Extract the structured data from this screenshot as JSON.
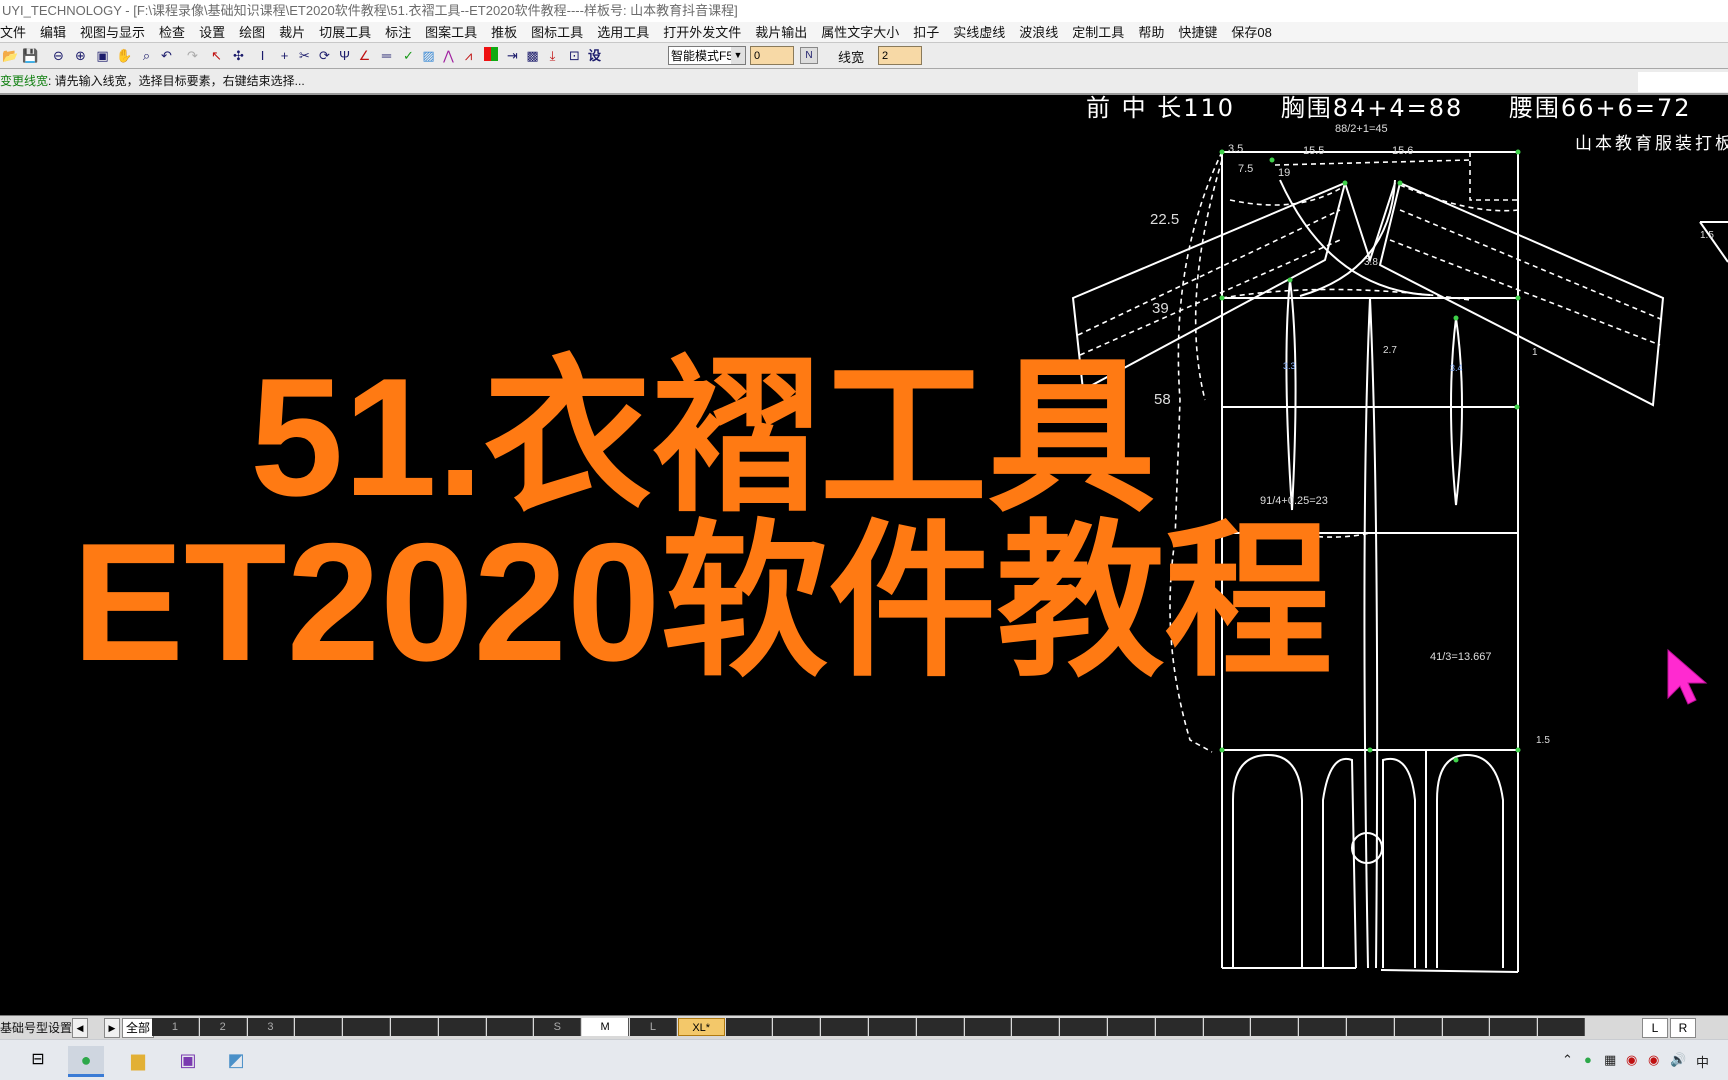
{
  "window": {
    "title": "UYI_TECHNOLOGY - [F:\\课程录像\\基础知识课程\\ET2020软件教程\\51.衣褶工具--ET2020软件教程----样板号: 山本教育抖音课程]"
  },
  "menu": [
    "文件",
    "编辑",
    "视图与显示",
    "检查",
    "设置",
    "绘图",
    "裁片",
    "切展工具",
    "标注",
    "图案工具",
    "推板",
    "图标工具",
    "选用工具",
    "打开外发文件",
    "裁片输出",
    "属性文字大小",
    "扣子",
    "实线虚线",
    "波浪线",
    "定制工具",
    "帮助",
    "快捷键",
    "保存08"
  ],
  "toolbar": {
    "mode_value": "智能模式F5",
    "input1_value": "0",
    "line_width_label": "线宽",
    "line_width_value": "2",
    "settings_glyph": "设"
  },
  "command": {
    "name": "变更线宽",
    "prompt": ": 请先输入线宽，选择目标要素，右键结束选择..."
  },
  "drawing": {
    "header": {
      "front_length": "前 中 长110",
      "bust": "胸围84+4=88",
      "waist": "腰围66+6=72"
    },
    "watermark": "山本教育服装打板",
    "labels": {
      "top_width": "88/2+1=45",
      "l_3_5": "3.5",
      "l_15_5": "15.5",
      "l_15_6": "15.6",
      "l_7_5": "7.5",
      "l_19": "19",
      "l_22_5": "22.5",
      "l_39": "39",
      "l_58": "58",
      "l_3_8": "3.8",
      "l_2_7": "2.7",
      "l_3_3": "3.3",
      "l_3_4": "3.4",
      "l_1": "1",
      "l_waist": "91/4+0.25=23",
      "l_hem": "41/3=13.667",
      "l_1_5": "1.5",
      "l_side_1_5": "1.5"
    }
  },
  "banner": {
    "line1": "51.衣褶工具",
    "line2": "ET2020软件教程"
  },
  "sizebar": {
    "set_label": "基础号型设置",
    "all_label": "全部",
    "sizes": [
      "1",
      "2",
      "3",
      "",
      "",
      "",
      "",
      "",
      "S",
      "M",
      "L",
      "XL*",
      "",
      "",
      "",
      "",
      "",
      "",
      "",
      "",
      "",
      "",
      "",
      "",
      "",
      "",
      "",
      "",
      "",
      ""
    ],
    "base_size": "M",
    "active_size": "XL*",
    "right_buttons": [
      "L",
      "R"
    ]
  },
  "taskbar": {
    "tray_text": "中"
  },
  "colors": {
    "banner": "#ff7a13",
    "cad_lines": "#ffffff",
    "cad_points": "#3fd14a",
    "cursor": "#ff2ad0"
  }
}
